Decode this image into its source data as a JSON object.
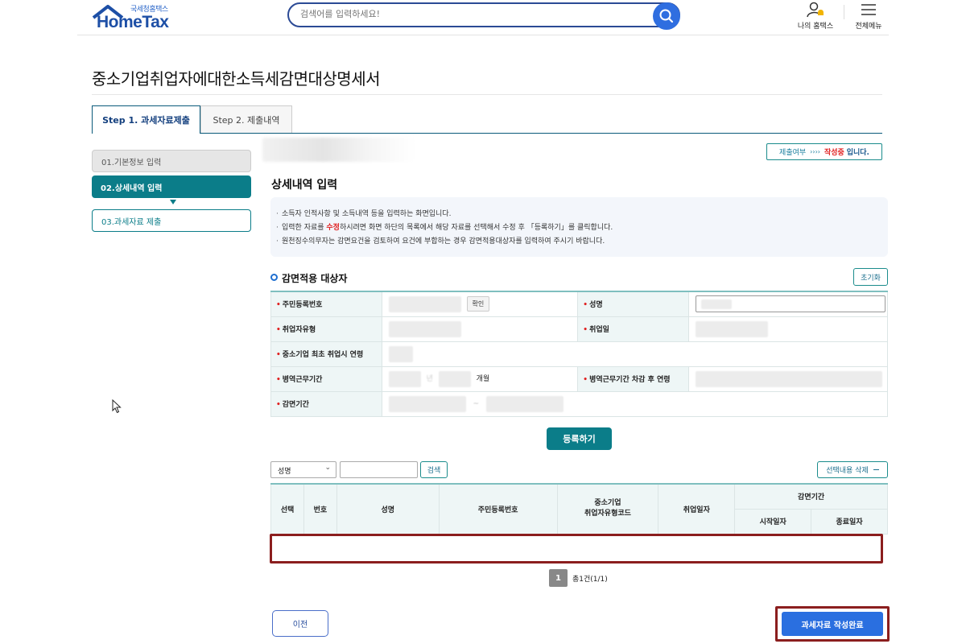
{
  "header": {
    "logo_sub": "국세청홈택스",
    "logo_main": "HomeTax",
    "search_placeholder": "검색어를 입력하세요!",
    "my_hometax_label": "나의 홈택스",
    "full_menu_label": "전체메뉴"
  },
  "page": {
    "title": "중소기업취업자에대한소득세감면대상명세서"
  },
  "tabs": [
    {
      "label": "Step 1. 과세자료제출",
      "active": true
    },
    {
      "label": "Step 2. 제출내역",
      "active": false
    }
  ],
  "steps": [
    {
      "label": "01.기본정보 입력",
      "state": "done"
    },
    {
      "label": "02.상세내역 입력",
      "state": "current"
    },
    {
      "label": "03.과세자료 제출",
      "state": "todo"
    }
  ],
  "status": {
    "key": "제출여부",
    "arrow": "››››",
    "value": "작성중",
    "tail": "입니다."
  },
  "section": {
    "title": "상세내역 입력",
    "guide": [
      {
        "pre": "소득자 인적사항 및 소득내역 등을 입력하는 화면입니다.",
        "red": "",
        "post": ""
      },
      {
        "pre": "입력한 자료를 ",
        "red": "수정",
        "post": "하시려면 화면 하단의 목록에서 해당 자료를 선택해서 수정 후 「등록하기」를 클릭합니다."
      },
      {
        "pre": "원천징수의무자는 감면요건을 검토하여 요건에 부합하는 경우 감면적용대상자를 입력하여 주시기 바랍니다.",
        "red": "",
        "post": ""
      }
    ]
  },
  "form": {
    "subtitle": "감면적용 대상자",
    "reset_label": "초기화",
    "rrn_label": "주민등록번호",
    "confirm_label": "확인",
    "name_label": "성명",
    "type_label": "취업자유형",
    "hire_date_label": "취업일",
    "first_age_label": "중소기업 최초 취업시 연령",
    "military_label": "병역근무기간",
    "military_unit_year": "년",
    "military_unit_month": "개월",
    "after_age_label": "병역근무기간 차감 후 연령",
    "period_label": "감면기간",
    "period_sep": "~",
    "register_label": "등록하기"
  },
  "list": {
    "filter_select": "성명",
    "search_label": "검색",
    "delete_label": "선택내용 삭제",
    "delete_icon": "minus-icon",
    "headers": {
      "select": "선택",
      "no": "번호",
      "name": "성명",
      "rrn": "주민등록번호",
      "type_code": "중소기업\n취업자유형코드",
      "hire_date": "취업일자",
      "period": "감면기간",
      "start": "시작일자",
      "end": "종료일자"
    },
    "rows": []
  },
  "pagination": {
    "current": "1",
    "total_text": "총1건(1/1)"
  },
  "footer": {
    "prev_label": "이전",
    "complete_label": "과세자료 작성완료"
  },
  "colors": {
    "teal": "#0b7d89",
    "navy": "#2b4a95",
    "blue": "#2a6fe0",
    "red": "#e02020",
    "highlight": "#8b1e1e"
  }
}
